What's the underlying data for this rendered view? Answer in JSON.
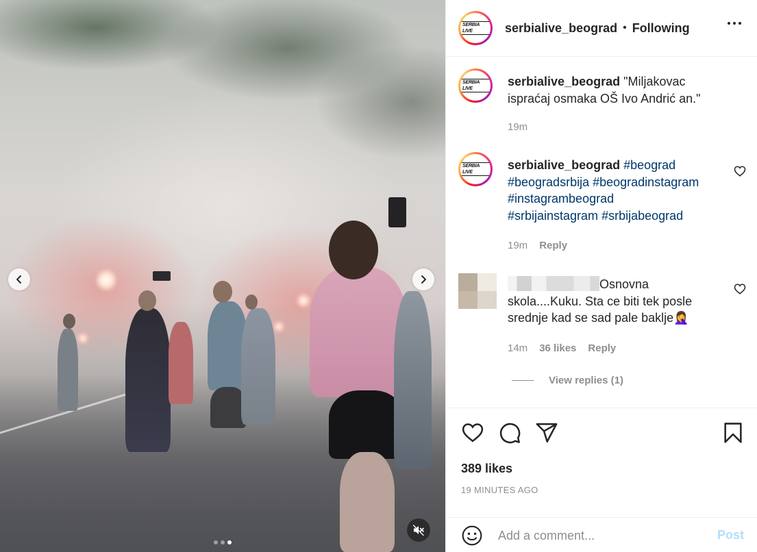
{
  "media": {
    "prev_icon": "chevron-left-icon",
    "next_icon": "chevron-right-icon",
    "mute_icon": "speaker-muted-icon",
    "slide_count": 3,
    "active_slide": 3
  },
  "header": {
    "avatar_text": "SERBIA LIVE",
    "username": "serbialive_beograd",
    "separator": "•",
    "follow_status": "Following",
    "more_icon": "more-options-icon"
  },
  "comments": [
    {
      "avatar_text": "SERBIA LIVE",
      "username": "serbialive_beograd",
      "text": "\"Miljakovac ispraćaj osmaka OŠ Ivo Andrić an.\"",
      "time": "19m"
    },
    {
      "avatar_text": "SERBIA LIVE",
      "username": "serbialive_beograd",
      "hashtags": [
        "#beograd",
        "#beogradsrbija",
        "#beogradinstagram",
        "#instagrambeograd",
        "#srbijainstagram",
        "#srbijabeograd"
      ],
      "time": "19m",
      "reply_label": "Reply"
    },
    {
      "text": "Osnovna skola....Kuku. Sta ce biti tek posle srednje kad se sad pale baklje🤦‍♀️",
      "time": "14m",
      "likes": "36 likes",
      "reply_label": "Reply",
      "view_replies": "View replies (1)"
    }
  ],
  "actions": {
    "like_icon": "heart-icon",
    "comment_icon": "comment-bubble-icon",
    "share_icon": "paper-plane-icon",
    "save_icon": "bookmark-icon",
    "likes": "389 likes",
    "time_ago": "19 MINUTES AGO"
  },
  "add_comment": {
    "emoji_icon": "smiley-icon",
    "placeholder": "Add a comment...",
    "post_label": "Post"
  },
  "colors": {
    "text": "#262626",
    "secondary": "#8e8e8e",
    "hashtag": "#00376b",
    "post_disabled": "#b2dffc",
    "border": "#efefef"
  }
}
